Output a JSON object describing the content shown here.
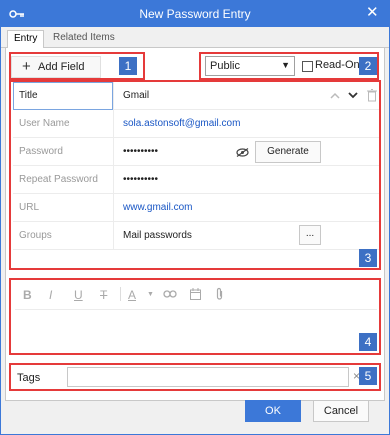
{
  "window": {
    "title": "New Password Entry",
    "icon": "key-icon",
    "close_glyph": "✕"
  },
  "tabs": [
    {
      "label": "Entry",
      "active": true
    },
    {
      "label": "Related Items",
      "active": false
    }
  ],
  "toolbar": {
    "add_field_label": "Add Field",
    "add_field_glyph": "+",
    "visibility_select_value": "Public",
    "read_only_label": "Read-Only",
    "read_only_checked": false
  },
  "fields": [
    {
      "label": "Title",
      "value": "Gmail"
    },
    {
      "label": "User Name",
      "value": "sola.astonsoft@gmail.com"
    },
    {
      "label": "Password",
      "value": "••••••••••"
    },
    {
      "label": "Repeat Password",
      "value": "••••••••••"
    },
    {
      "label": "URL",
      "value": "www.gmail.com"
    },
    {
      "label": "Groups",
      "value": "Mail passwords"
    }
  ],
  "generate_label": "Generate",
  "groups_browse_label": "...",
  "editor_toolbar": [
    "B",
    "I",
    "U",
    "T",
    "A"
  ],
  "tags": {
    "label": "Tags",
    "value": "",
    "clear_glyph": "×"
  },
  "buttons": {
    "ok": "OK",
    "cancel": "Cancel"
  },
  "badges": [
    "1",
    "2",
    "3",
    "4",
    "5"
  ],
  "colors": {
    "accent": "#3c78d8",
    "annotation_red": "#e53a3a",
    "badge_blue": "#3d70c4",
    "link": "#1a57c5"
  }
}
